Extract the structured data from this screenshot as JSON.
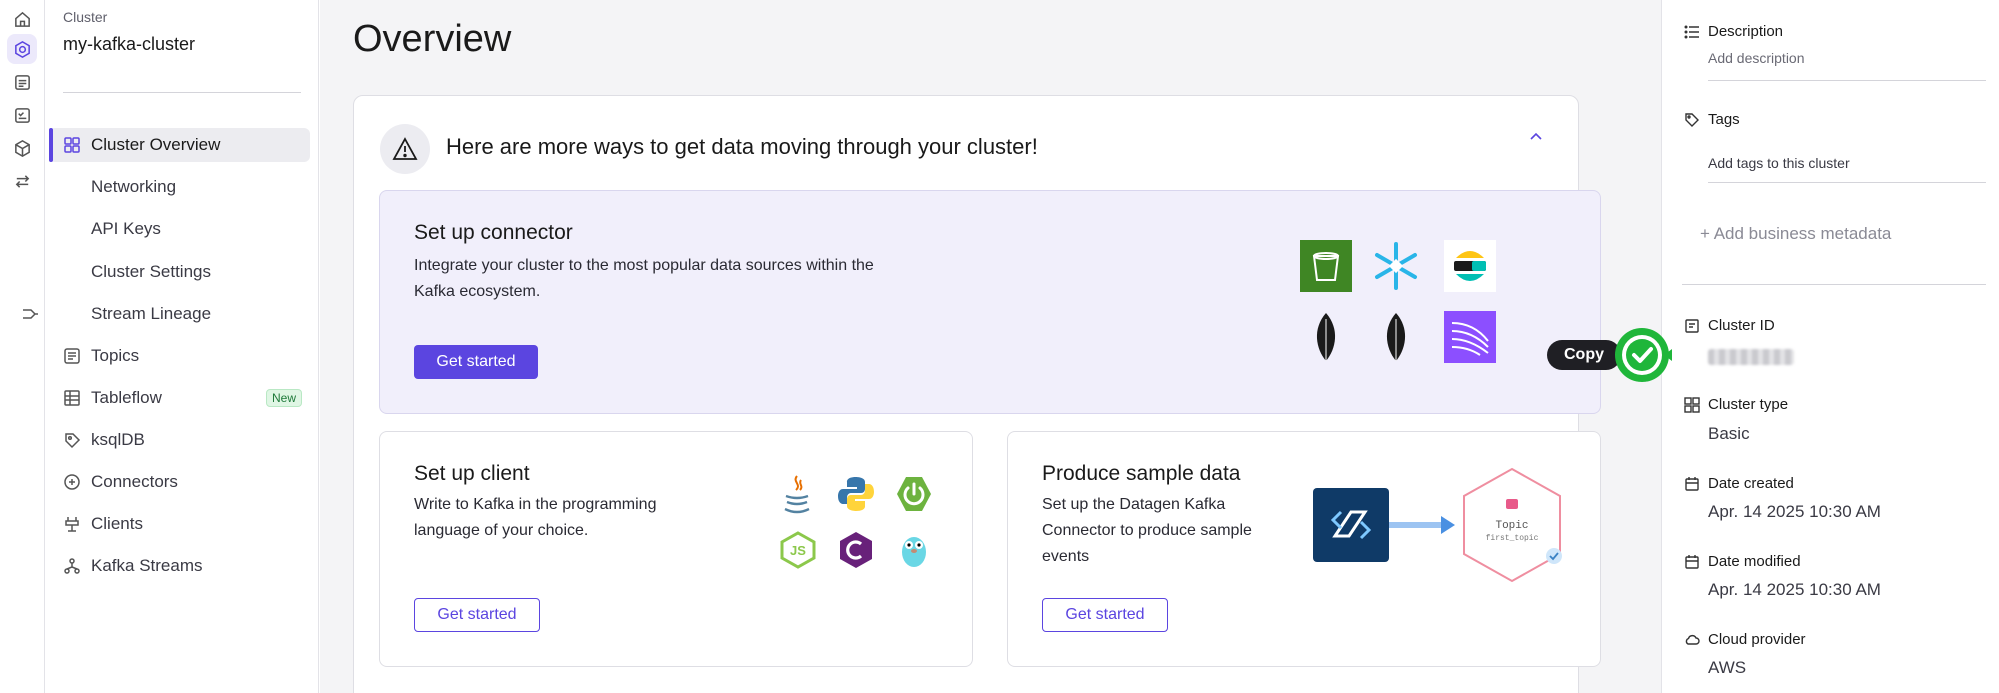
{
  "rail": {
    "icons": [
      "home-icon",
      "cluster-icon",
      "document-icon",
      "checklist-icon",
      "package-icon",
      "swap-icon"
    ]
  },
  "sidebar": {
    "cluster_caption": "Cluster",
    "cluster_name": "my-kafka-cluster",
    "items": [
      {
        "label": "Cluster Overview",
        "icon": "grid-icon"
      },
      {
        "label": "Networking"
      },
      {
        "label": "API Keys"
      },
      {
        "label": "Cluster Settings"
      },
      {
        "label": "Stream Lineage",
        "icon": "lineage-icon"
      },
      {
        "label": "Topics",
        "icon": "topics-icon"
      },
      {
        "label": "Tableflow",
        "icon": "table-icon",
        "badge": "New"
      },
      {
        "label": "ksqlDB",
        "icon": "ksqldb-icon"
      },
      {
        "label": "Connectors",
        "icon": "connectors-icon"
      },
      {
        "label": "Clients",
        "icon": "clients-icon"
      },
      {
        "label": "Kafka Streams",
        "icon": "streams-icon"
      }
    ]
  },
  "main": {
    "title": "Overview",
    "banner": "Here are more ways to get data moving through your cluster!",
    "connector": {
      "title": "Set up connector",
      "description": "Integrate your cluster to the most popular data sources within the Kafka ecosystem.",
      "button": "Get started",
      "logos": [
        "s3-bucket-icon",
        "snowflake-icon",
        "elastic-icon",
        "mongodb-icon",
        "mongodb-icon",
        "kinesis-icon"
      ]
    },
    "client": {
      "title": "Set up client",
      "description": "Write to Kafka in the programming language of your choice.",
      "button": "Get started",
      "logos": [
        "java-icon",
        "python-icon",
        "spring-icon",
        "nodejs-icon",
        "csharp-icon",
        "go-icon"
      ]
    },
    "sample": {
      "title": "Produce sample data",
      "description": "Set up the Datagen Kafka Connector to produce sample events",
      "button": "Get started",
      "topic_label": "Topic",
      "topic_name": "first_topic"
    }
  },
  "details": {
    "description_label": "Description",
    "description_placeholder": "Add description",
    "tags_label": "Tags",
    "tags_placeholder": "Add tags to this cluster",
    "add_metadata": "+  Add business metadata",
    "cluster_id_label": "Cluster ID",
    "cluster_type_label": "Cluster type",
    "cluster_type": "Basic",
    "date_created_label": "Date created",
    "date_created": "Apr. 14 2025 10:30 AM",
    "date_modified_label": "Date modified",
    "date_modified": "Apr. 14 2025 10:30 AM",
    "cloud_provider_label": "Cloud provider",
    "cloud_provider": "AWS",
    "copy_tooltip": "Copy"
  },
  "colors": {
    "accent": "#5b45e0",
    "copy_success": "#1fb63a"
  }
}
